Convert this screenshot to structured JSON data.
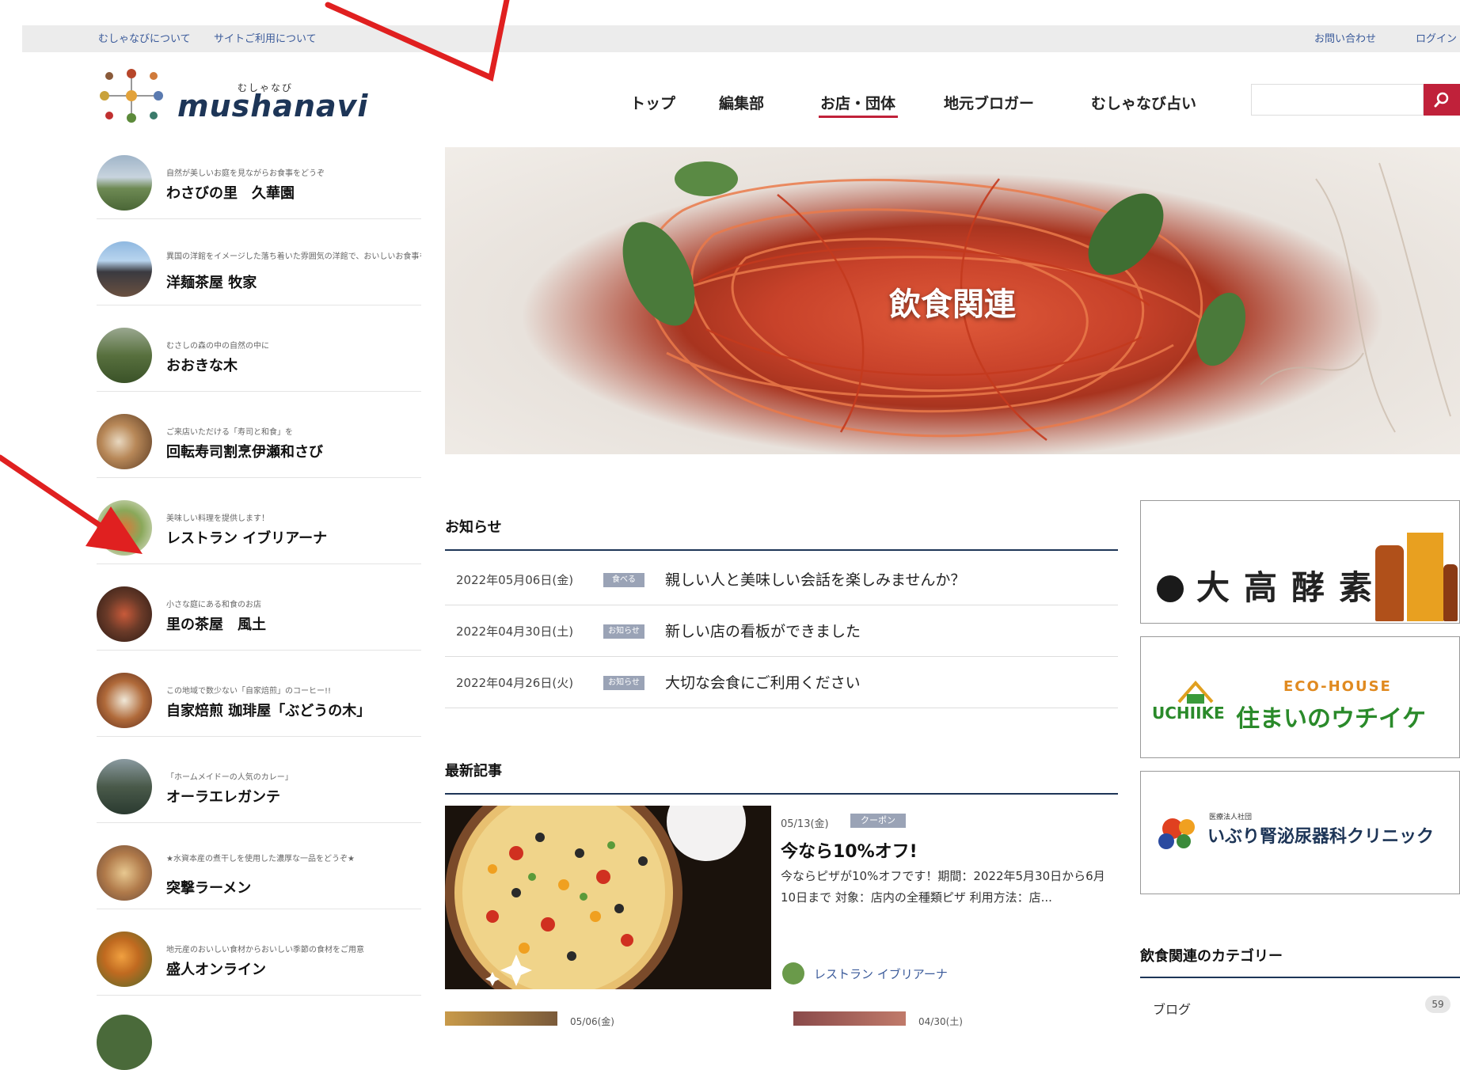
{
  "utility_bar": {
    "about": "むしゃなびについて",
    "usage": "サイトご利用について",
    "contact": "お問い合わせ",
    "login": "ログイン"
  },
  "logo": {
    "ruby": "むしゃなび",
    "text": "mushanavi"
  },
  "nav": {
    "items": [
      "トップ",
      "編集部",
      "お店・団体",
      "地元ブロガー",
      "むしゃなび占い"
    ],
    "active": "お店・団体"
  },
  "search": {
    "placeholder": "",
    "icon": "search-icon"
  },
  "sidebar": {
    "items": [
      {
        "sub": "自然が美しいお庭を見ながらお食事をどうぞ",
        "title": "わさびの里　久華園"
      },
      {
        "sub": "異国の洋館をイメージした落ち着いた雰囲気の洋館で、おいしいお食事をお楽しみ",
        "title": "洋麺茶屋 牧家"
      },
      {
        "sub": "むさしの森の中の自然の中に",
        "title": "おおきな木"
      },
      {
        "sub": "ご来店いただける「寿司と和食」を",
        "title": "回転寿司割烹伊瀬和さび"
      },
      {
        "sub": "美味しい料理を提供します！",
        "title": "レストラン イブリアーナ"
      },
      {
        "sub": "小さな庭にある和食のお店",
        "title": "里の茶屋　風土"
      },
      {
        "sub": "この地域で数少ない「自家焙煎」のコーヒー!!",
        "title": "自家焙煎 珈琲屋「ぶどうの木」"
      },
      {
        "sub": "「ホームメイドーの人気のカレー」",
        "title": "オーラエレガンテ"
      },
      {
        "sub": "★水資本産の煮干しを使用した濃厚な一品をどうぞ★",
        "title": "突撃ラーメン"
      },
      {
        "sub": "地元産のおいしい食材からおいしい季節の食材をご用意",
        "title": "盛人オンライン"
      }
    ]
  },
  "hero": {
    "title": "飲食関連"
  },
  "news": {
    "heading": "お知らせ",
    "items": [
      {
        "date": "2022年05月06日(金)",
        "badge": "食べる",
        "text": "親しい人と美味しい会話を楽しみませんか？"
      },
      {
        "date": "2022年04月30日(土)",
        "badge": "お知らせ",
        "text": "新しい店の看板ができました"
      },
      {
        "date": "2022年04月26日(火)",
        "badge": "お知らせ",
        "text": "大切な会食にご利用ください"
      }
    ]
  },
  "latest": {
    "heading": "最新記事",
    "article": {
      "date": "05/13(金)",
      "badge": "クーポン",
      "title": "今なら10%オフ!",
      "body": "今ならピザが10%オフです！期間：2022年5月30日から6月10日まで 対象：店内の全種類ピザ 利用方法：店...",
      "shop": "レストラン イブリアーナ"
    },
    "row2": [
      {
        "date": "05/06(金)"
      },
      {
        "date": "04/30(土)"
      }
    ]
  },
  "ads": {
    "ad1": {
      "text": "大高酵素"
    },
    "ad2": {
      "top": "ECO-HOUSE",
      "brand": "UCHIIKE",
      "text": "住まいのウチイケ"
    },
    "ad3": {
      "small": "医療法人社団",
      "text": "いぶり腎泌尿器科クリニック"
    }
  },
  "category": {
    "heading": "飲食関連のカテゴリー",
    "items": [
      {
        "label": "ブログ",
        "count": "59"
      }
    ]
  },
  "colors": {
    "accent": "#c0213a",
    "navy": "#1d3557",
    "annotation": "#e02020"
  }
}
